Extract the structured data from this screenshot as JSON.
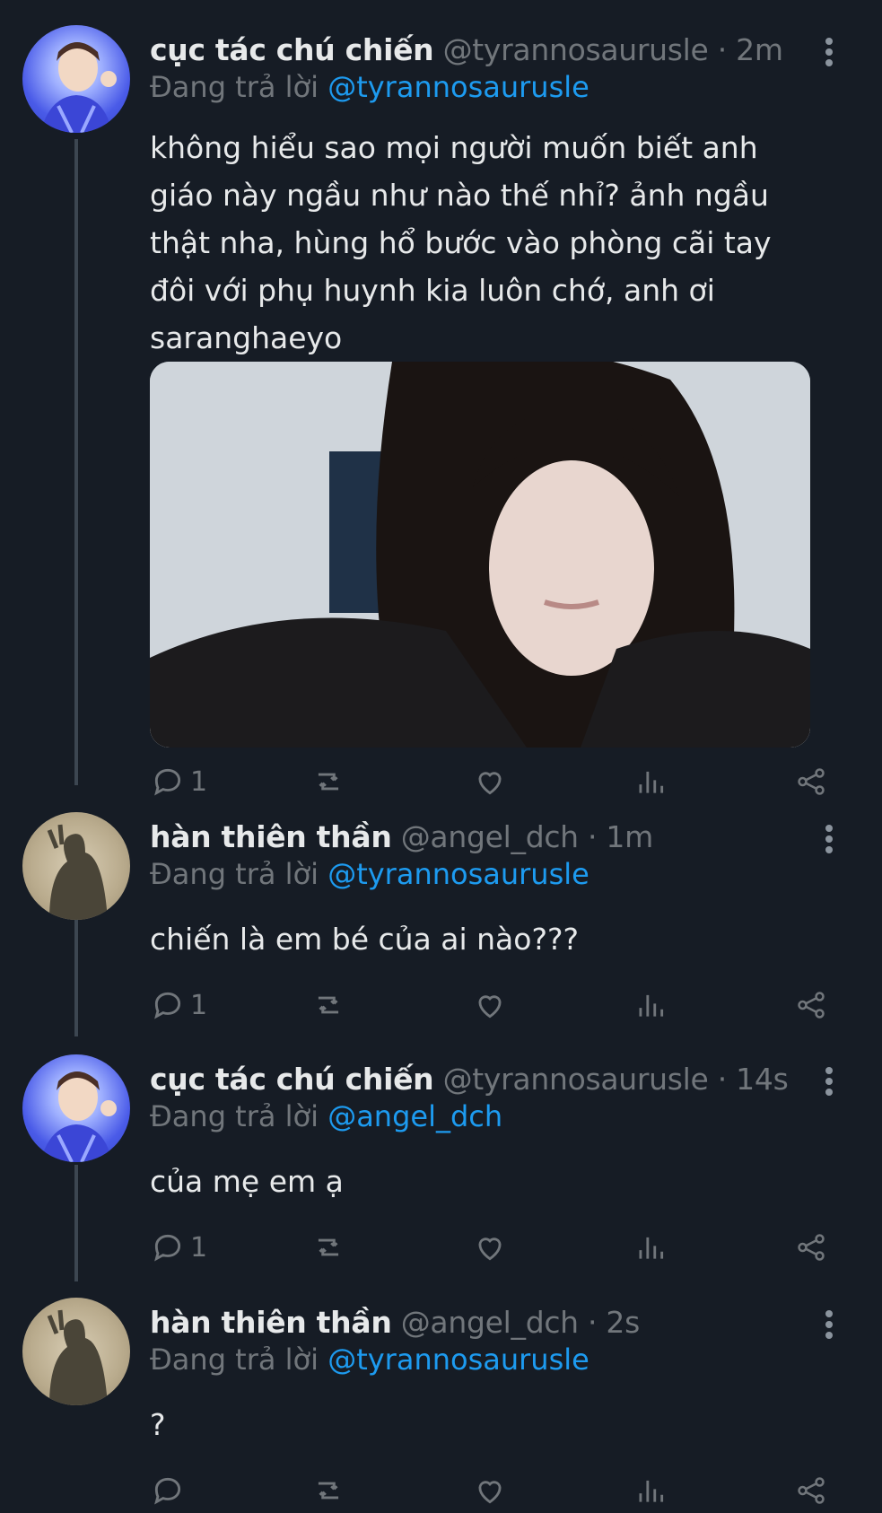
{
  "tweets": [
    {
      "name": "cục tác chú chiến",
      "handle": "@tyrannosaurusle",
      "time": "2m",
      "reply_prefix": "Đang trả lời",
      "reply_to": "@tyrannosaurusle",
      "text": "không hiểu sao mọi người muốn biết anh giáo này ngầu như nào thế nhỉ? ảnh ngầu thật nha, hùng hổ bước vào phòng cãi tay đôi với phụ huynh kia luôn chớ, anh ơi saranghaeyo",
      "reply_count": "1",
      "has_media": true
    },
    {
      "name": "hàn thiên thần",
      "handle": "@angel_dch",
      "time": "1m",
      "reply_prefix": "Đang trả lời",
      "reply_to": "@tyrannosaurusle",
      "text": "chiến là em bé của ai nào???",
      "reply_count": "1"
    },
    {
      "name": "cục tác chú chiến",
      "handle": "@tyrannosaurusle",
      "time": "14s",
      "reply_prefix": "Đang trả lời",
      "reply_to": "@angel_dch",
      "text": "của mẹ em ạ",
      "reply_count": "1"
    },
    {
      "name": "hàn thiên thần",
      "handle": "@angel_dch",
      "time": "2s",
      "reply_prefix": "Đang trả lời",
      "reply_to": "@tyrannosaurusle",
      "text": "?",
      "reply_count": ""
    }
  ],
  "separator": "·",
  "icons": {
    "reply": "reply-icon",
    "retweet": "retweet-icon",
    "like": "heart-icon",
    "views": "views-icon",
    "share": "share-icon",
    "more": "more-vertical-icon"
  },
  "colors": {
    "background": "#161c25",
    "link": "#1d9bf0",
    "muted": "#71767b",
    "text": "#e7e9ea"
  }
}
